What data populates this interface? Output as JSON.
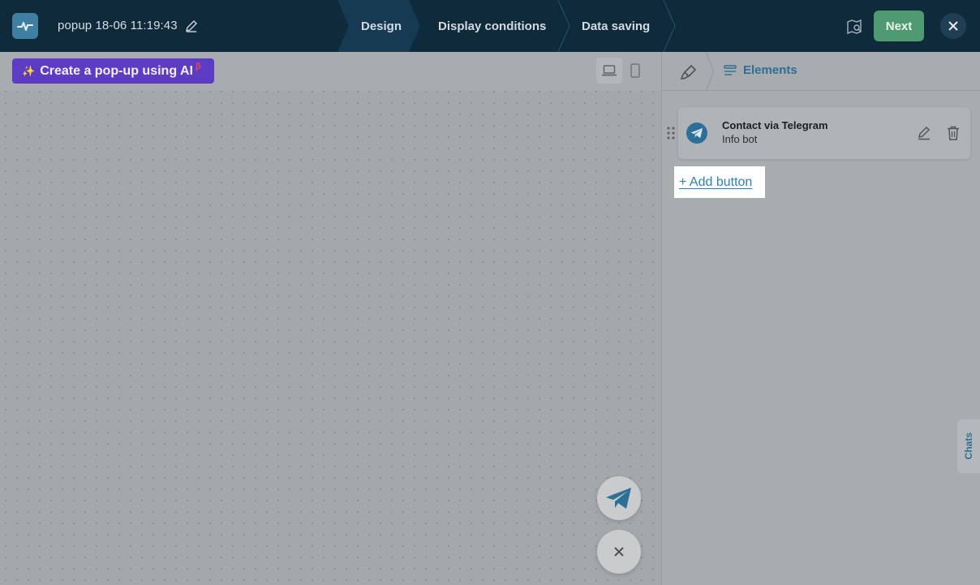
{
  "header": {
    "title": "popup 18-06 11:19:43",
    "steps": [
      "Design",
      "Display conditions",
      "Data saving"
    ],
    "next_label": "Next",
    "colors": {
      "bar": "#0e2a3b",
      "next": "#4f9a70"
    }
  },
  "canvas": {
    "ai_button": {
      "spark": "✨",
      "label": "Create a pop-up using AI",
      "beta": "β"
    },
    "device_modes": [
      "desktop-icon",
      "mobile-icon"
    ],
    "fab_icons": [
      "telegram-icon",
      "close-icon"
    ]
  },
  "panel": {
    "tab_label": "Elements",
    "items": [
      {
        "title": "Contact via Telegram",
        "subtitle": "Info bot",
        "icon": "telegram-icon"
      }
    ],
    "add_button_label": "+ Add button"
  },
  "chats_label": "Chats"
}
